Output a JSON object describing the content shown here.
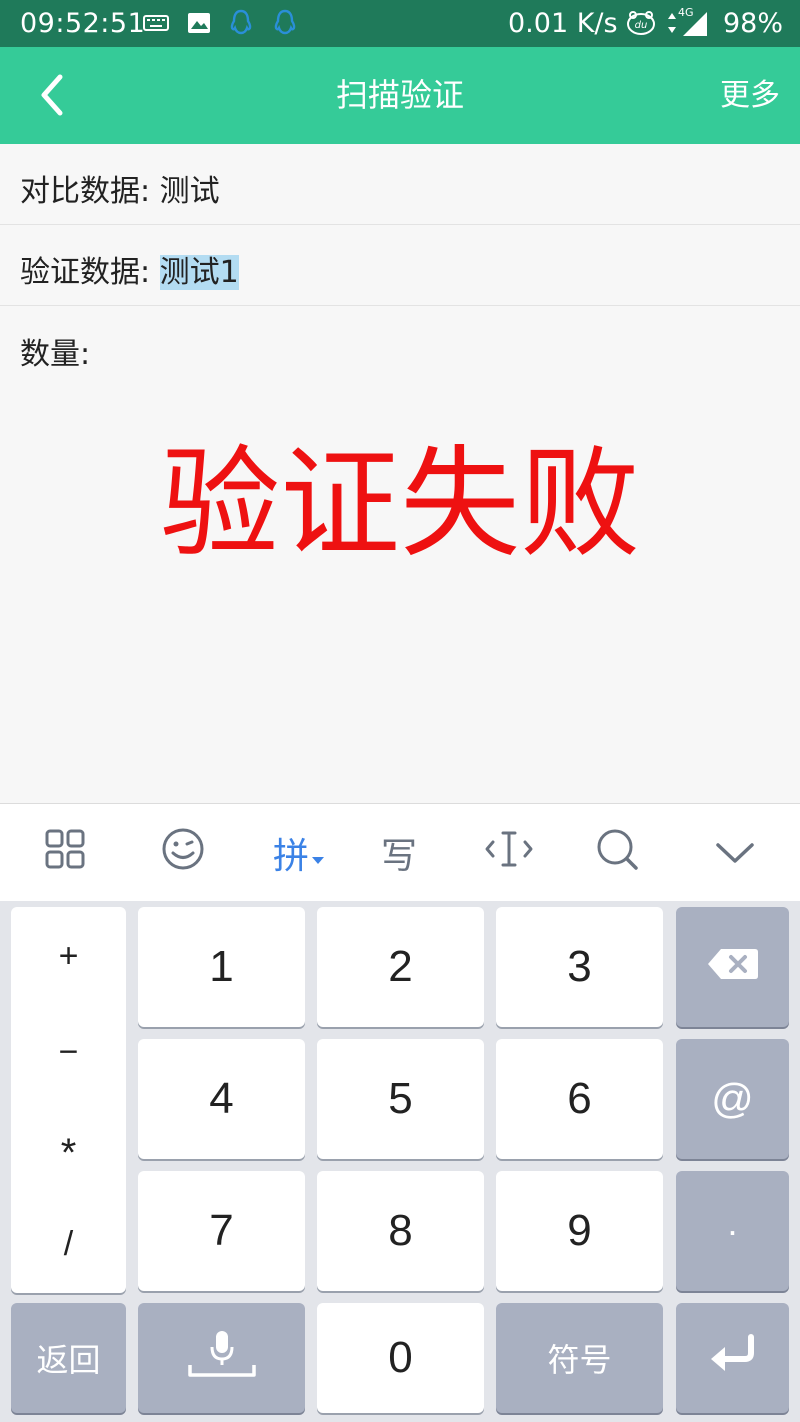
{
  "status_bar": {
    "time": "09:52:51",
    "speed": "0.01 K/s",
    "network": "4G",
    "battery": "98%",
    "icons": [
      "keyboard-icon",
      "image-icon",
      "qq-icon",
      "qq-icon",
      "du-icon",
      "data-arrows-icon",
      "signal-icon"
    ]
  },
  "header": {
    "back_icon": "chevron-left-icon",
    "title": "扫描验证",
    "more": "更多"
  },
  "rows": {
    "compare_label": "对比数据: ",
    "compare_value": "测试",
    "verify_label": "验证数据: ",
    "verify_value": "测试1",
    "quantity_label": "数量:"
  },
  "result": "验证失败",
  "keyboard_toolbar": {
    "items": [
      "grid-icon",
      "emoji-icon",
      "拼",
      "写",
      "cursor-icon",
      "search-icon",
      "chevron-down-icon"
    ]
  },
  "keyboard": {
    "symbols": [
      "+",
      "−",
      "*",
      "/"
    ],
    "digits": [
      "1",
      "2",
      "3",
      "4",
      "5",
      "6",
      "7",
      "8",
      "9",
      "0"
    ],
    "at": "@",
    "dot": "·",
    "back": "返回",
    "symbol_key": "符号"
  },
  "colors": {
    "status_bar": "#1f7a5a",
    "title_bar": "#35cb98",
    "result_text": "#ee1111",
    "selection": "#b3dcf2",
    "pinyin_accent": "#3b82e6"
  }
}
